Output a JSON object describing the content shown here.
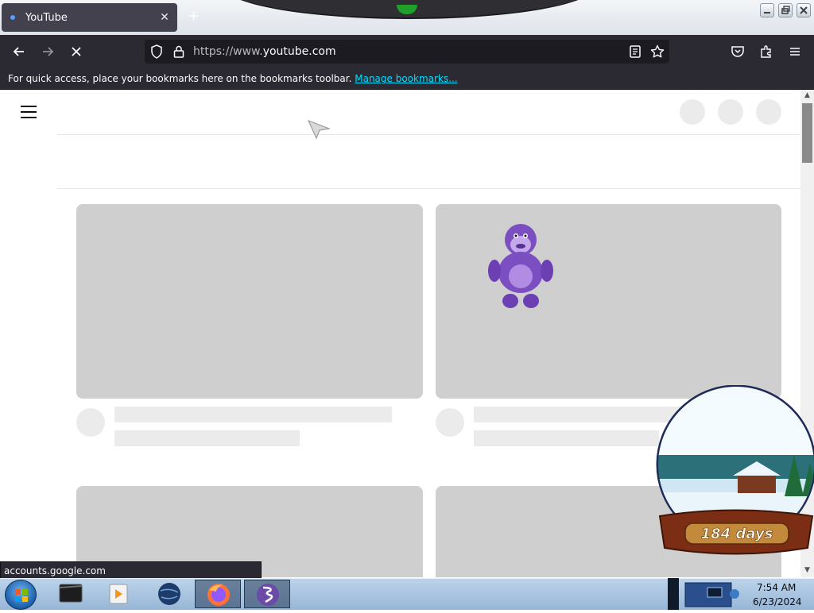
{
  "browser": {
    "tab": {
      "title": "YouTube",
      "close_glyph": "✕"
    },
    "new_tab_glyph": "+",
    "url": {
      "prefix": "https://www.",
      "domain": "youtube.com"
    },
    "bookmarks_bar": {
      "message": "For quick access, place your bookmarks here on the bookmarks toolbar.",
      "link": "Manage bookmarks..."
    },
    "status_url": "accounts.google.com",
    "icons": [
      "back-arrow-icon",
      "forward-arrow-icon",
      "stop-loading-icon",
      "shield-icon",
      "lock-icon",
      "reader-view-icon",
      "bookmark-star-icon",
      "pocket-icon",
      "extensions-icon",
      "menu-icon"
    ]
  },
  "youtube": {
    "state": "loading-skeleton",
    "colors": {
      "thumb": "#cfcfcf",
      "skeleton": "#ebebeb"
    }
  },
  "taskbar": {
    "clock": {
      "time": "7:54 AM",
      "date": "6/23/2024"
    },
    "apps": [
      "start-orb",
      "terminal-app",
      "media-player-app",
      "globe-app",
      "firefox-app",
      "emacs-app"
    ]
  },
  "gadget": {
    "snow_globe_label": "184 days"
  },
  "colors": {
    "browser_chrome": "#2b2a33",
    "url_field": "#1c1b22",
    "link": "#00ddff",
    "taskbar": "#a9c4e0"
  }
}
